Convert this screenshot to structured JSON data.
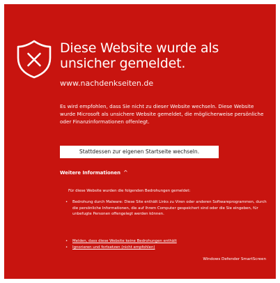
{
  "colors": {
    "background_red": "#c8140f",
    "text": "#ffffff",
    "button_bg": "#ffffff",
    "button_text": "#222222"
  },
  "warning": {
    "icon": "shield-x-icon",
    "title": "Diese Website wurde als unsicher gemeldet.",
    "url": "www.nachdenkseiten.de",
    "description": "Es wird empfohlen, dass Sie nicht zu dieser Website wechseln. Diese Website wurde Microsoft als unsichere Website gemeldet, die möglicherweise persönliche oder Finanzinformationen offenlegt."
  },
  "actions": {
    "safe_button_label": "Stattdessen zur eigenen Startseite wechseln."
  },
  "details": {
    "toggle_label": "Weitere Informationen",
    "toggle_icon": "chevron-up-icon",
    "intro": "Für diese Website wurden die folgenden Bedrohungen gemeldet:",
    "threat_text": "Bedrohung durch Malware: Diese Site enthält Links zu Viren oder anderen Softwareprogrammen, durch die persönliche Informationen, die auf Ihrem Computer gespeichert sind oder die Sie eingeben, für unbefugte Personen offengelegt werden können.",
    "links": [
      "Melden, dass diese Website keine Bedrohungen enthält",
      "Ignorieren und fortsetzen (nicht empfohlen)"
    ]
  },
  "footer": {
    "brand": "Windows Defender SmartScreen"
  }
}
